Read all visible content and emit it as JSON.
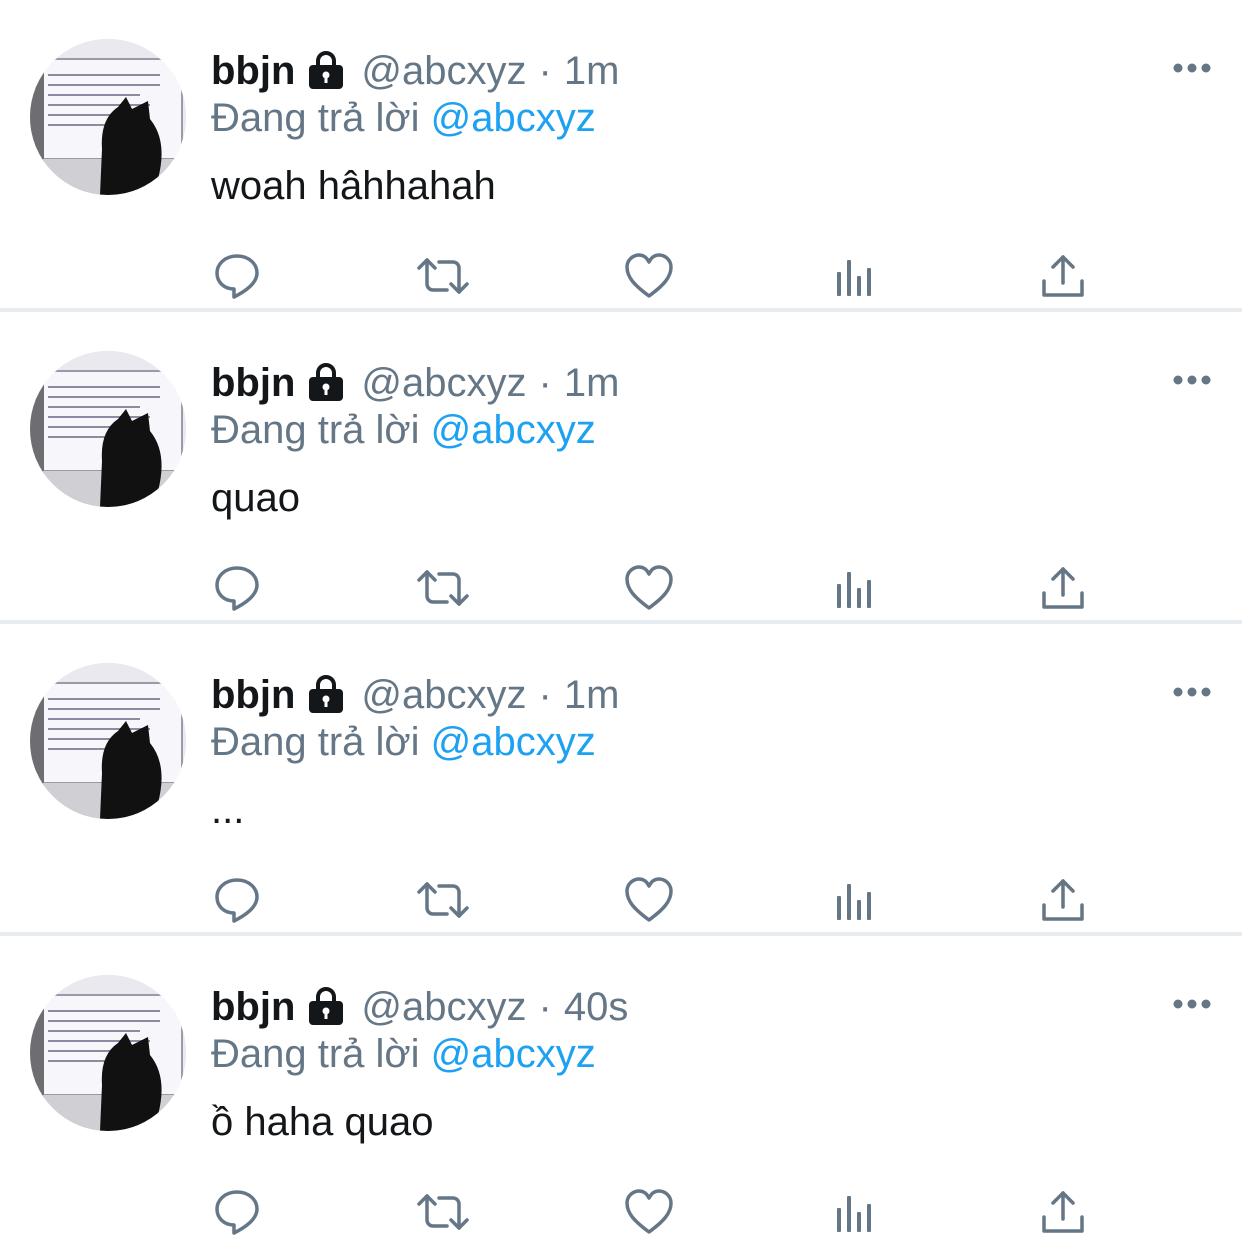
{
  "tweets": [
    {
      "name": "bbjn",
      "handle": "@abcxyz",
      "separator": "·",
      "time": "1m",
      "reply_prefix": "Đang trả lời",
      "reply_to": "@abcxyz",
      "text": "woah hâhhahah"
    },
    {
      "name": "bbjn",
      "handle": "@abcxyz",
      "separator": "·",
      "time": "1m",
      "reply_prefix": "Đang trả lời",
      "reply_to": "@abcxyz",
      "text": "quao"
    },
    {
      "name": "bbjn",
      "handle": "@abcxyz",
      "separator": "·",
      "time": "1m",
      "reply_prefix": "Đang trả lời",
      "reply_to": "@abcxyz",
      "text": "..."
    },
    {
      "name": "bbjn",
      "handle": "@abcxyz",
      "separator": "·",
      "time": "40s",
      "reply_prefix": "Đang trả lời",
      "reply_to": "@abcxyz",
      "text": "ồ haha quao"
    }
  ],
  "icons": {
    "locked": "lock-icon",
    "more": "more-icon",
    "actions": [
      "reply-icon",
      "retweet-icon",
      "like-icon",
      "analytics-icon",
      "share-icon"
    ]
  },
  "colors": {
    "text_primary": "#14171a",
    "text_secondary": "#657786",
    "mention": "#1da1f2",
    "divider": "#e6ecf0",
    "icon": "#657786"
  }
}
